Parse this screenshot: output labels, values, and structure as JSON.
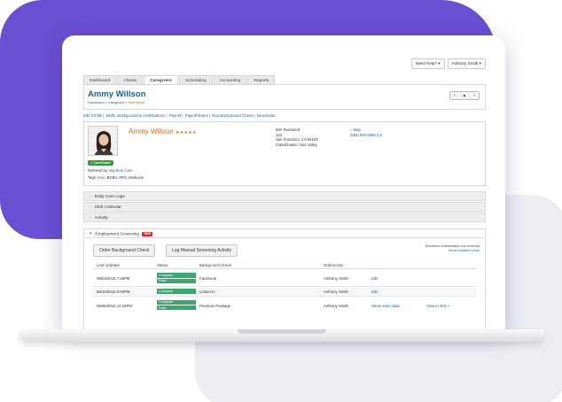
{
  "topbar": {
    "help": "Need Help? ▾",
    "user": "Anthony Smith ▾"
  },
  "tabs": [
    "Dashboard",
    "Clients",
    "Caregivers",
    "Scheduling",
    "Accounting",
    "Reports"
  ],
  "active_tab_index": 2,
  "header": {
    "title": "Ammy Willson",
    "breadcrumb": [
      "Dashboard",
      "Caregivers",
      "Beth Berns"
    ],
    "nav": [
      "‹",
      "▲",
      "›"
    ]
  },
  "action_links": [
    "Edit Profile",
    "Skills, Background & Certifications",
    "Payroll",
    "Payroll Rates",
    "Run Background Check",
    "Deactivate"
  ],
  "profile": {
    "name": "Ammy Willson",
    "rating": "★★★★★",
    "badge": "CareGuard",
    "referred_label": "Referred by:",
    "referred_value": "Big Bear Care",
    "tags": "Tags: AAA, BCBS, IPIO, Medicare",
    "address": [
      "650 Townsend",
      "123",
      "San Francisco, CA 94103",
      "Classification: Noe Valley"
    ],
    "map_label": "Map",
    "phone": "(555) 555-5555 (m)"
  },
  "sections": {
    "daily": "Daily Care Logs",
    "shift": "Shift Calendar",
    "activity": "Activity",
    "screening": "Employment Screening",
    "new_badge": "NEW"
  },
  "screening": {
    "btn_order": "Order Background Check",
    "btn_log": "Log Manual Screening Activity",
    "auth_line1": "Electronic Authorization not received",
    "auth_line2": "Send invitation email",
    "headers": [
      "Last Updated",
      "Status",
      "Background Check",
      "Ordered By"
    ],
    "rows": [
      {
        "date": "09/03/2015 7:48PM",
        "status": [
          "Complete",
          "Pass"
        ],
        "check": "Facebook",
        "by": "Anthony Smith",
        "action": "Edit",
        "extra": ""
      },
      {
        "date": "08/10/2015 9:00PM",
        "status": [
          "Complete"
        ],
        "check": "Linked-In",
        "by": "Anthony Smith",
        "action": "Edit",
        "extra": ""
      },
      {
        "date": "08/06/2015 12:20PM",
        "status": [
          "Complete",
          "Pass"
        ],
        "check": "Premium Package",
        "by": "Anthony Smith",
        "action": "Show order data",
        "extra": "View in GIS »"
      }
    ]
  },
  "colors": {
    "purple": "#6a4fd2",
    "title_blue": "#1f5e9c",
    "name_orange": "#e06a1d",
    "status_green": "#39a86f",
    "new_red": "#d2262c"
  }
}
